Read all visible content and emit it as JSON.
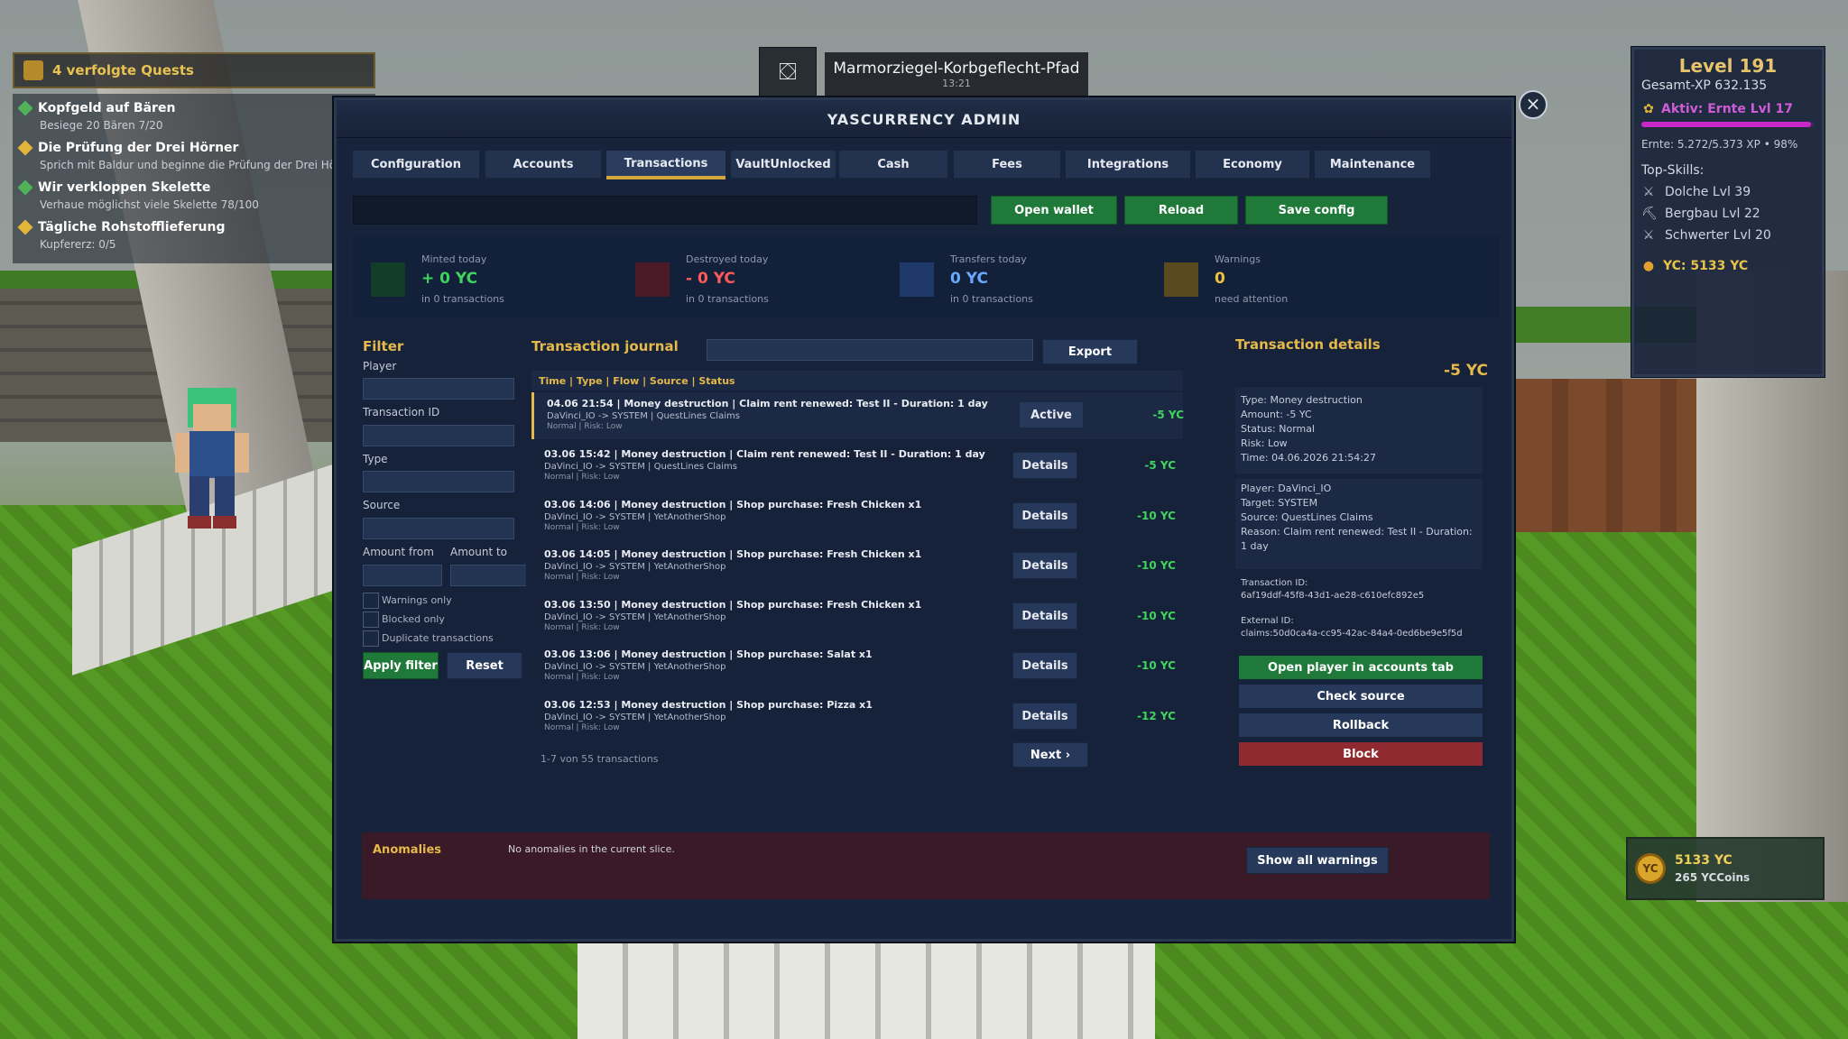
{
  "location": {
    "name": "Marmorziegel-Korbgeflecht-Pfad",
    "time": "13:21"
  },
  "quests": {
    "header": "4 verfolgte Quests",
    "items": [
      {
        "title": "Kopfgeld auf Bären",
        "sub": "Besiege 20 Bären 7/20"
      },
      {
        "title": "Die Prüfung der Drei Hörner",
        "sub": "Sprich mit Baldur und beginne die Prüfung der Drei Hörne"
      },
      {
        "title": "Wir verkloppen Skelette",
        "sub": "Verhaue möglichst viele Skelette 78/100"
      },
      {
        "title": "Tägliche Rohstofflieferung",
        "sub": "Kupfererz: 0/5"
      }
    ]
  },
  "level_panel": {
    "level": "Level 191",
    "xp": "Gesamt-XP 632.135",
    "active": "Aktiv: Ernte Lvl 17",
    "active_progress": 0.98,
    "ernte": "Ernte: 5.272/5.373 XP • 98%",
    "top_skills_label": "Top-Skills:",
    "skills": [
      "Dolche Lvl 39",
      "Bergbau Lvl 22",
      "Schwerter Lvl 20"
    ],
    "yc": "YC: 5133 YC"
  },
  "coin_widget": {
    "badge": "YC",
    "amount": "5133 YC",
    "coins": "265 YCCoins"
  },
  "admin": {
    "title": "YASCURRENCY ADMIN",
    "close": "×",
    "tabs": [
      "Configuration",
      "Accounts",
      "Transactions",
      "VaultUnlocked",
      "Cash",
      "Fees",
      "Integrations",
      "Economy",
      "Maintenance"
    ],
    "active_tab": "Transactions",
    "actions": {
      "open_wallet": "Open wallet",
      "reload": "Reload",
      "save": "Save config"
    },
    "stats": [
      {
        "label": "Minted today",
        "value": "+ 0 YC",
        "sub": "in 0 transactions",
        "color": "#3fd45d",
        "box": "#123e28"
      },
      {
        "label": "Destroyed today",
        "value": "- 0 YC",
        "sub": "in 0 transactions",
        "color": "#ff5a5a",
        "box": "#4a1a26"
      },
      {
        "label": "Transfers today",
        "value": "0 YC",
        "sub": "in 0 transactions",
        "color": "#6aa8ff",
        "box": "#1f3a6a"
      },
      {
        "label": "Warnings",
        "value": "0",
        "sub": "need attention",
        "color": "#f0c040",
        "box": "#5a4a20"
      }
    ],
    "filter": {
      "title": "Filter",
      "player": "Player",
      "txid": "Transaction ID",
      "type": "Type",
      "source": "Source",
      "amount_from": "Amount from",
      "amount_to": "Amount to",
      "warnings_only": "Warnings only",
      "blocked_only": "Blocked only",
      "duplicates": "Duplicate transactions",
      "apply": "Apply filter",
      "reset": "Reset"
    },
    "journal": {
      "title": "Transaction journal",
      "export": "Export",
      "columns": "Time | Type | Flow | Source | Status",
      "rows": [
        {
          "line1": "04.06 21:54 | Money destruction | Claim rent renewed: Test II - Duration: 1 day",
          "line2": "DaVinci_IO -> SYSTEM | QuestLines Claims",
          "line3": "Normal | Risk: Low",
          "button": "Active",
          "amount": "-5 YC"
        },
        {
          "line1": "03.06 15:42 | Money destruction | Claim rent renewed: Test II - Duration: 1 day",
          "line2": "DaVinci_IO -> SYSTEM | QuestLines Claims",
          "line3": "Normal | Risk: Low",
          "button": "Details",
          "amount": "-5 YC"
        },
        {
          "line1": "03.06 14:06 | Money destruction | Shop purchase: Fresh Chicken x1",
          "line2": "DaVinci_IO -> SYSTEM | YetAnotherShop",
          "line3": "Normal | Risk: Low",
          "button": "Details",
          "amount": "-10 YC"
        },
        {
          "line1": "03.06 14:05 | Money destruction | Shop purchase: Fresh Chicken x1",
          "line2": "DaVinci_IO -> SYSTEM | YetAnotherShop",
          "line3": "Normal | Risk: Low",
          "button": "Details",
          "amount": "-10 YC"
        },
        {
          "line1": "03.06 13:50 | Money destruction | Shop purchase: Fresh Chicken x1",
          "line2": "DaVinci_IO -> SYSTEM | YetAnotherShop",
          "line3": "Normal | Risk: Low",
          "button": "Details",
          "amount": "-10 YC"
        },
        {
          "line1": "03.06 13:06 | Money destruction | Shop purchase: Salat x1",
          "line2": "DaVinci_IO -> SYSTEM | YetAnotherShop",
          "line3": "Normal | Risk: Low",
          "button": "Details",
          "amount": "-10 YC"
        },
        {
          "line1": "03.06 12:53 | Money destruction | Shop purchase: Pizza x1",
          "line2": "DaVinci_IO -> SYSTEM | YetAnotherShop",
          "line3": "Normal | Risk: Low",
          "button": "Details",
          "amount": "-12 YC"
        }
      ],
      "pager": "1-7 von 55 transactions",
      "next": "Next ›"
    },
    "details": {
      "title": "Transaction details",
      "amount": "-5 YC",
      "type": "Type: Money destruction",
      "amount_line": "Amount: -5 YC",
      "status": "Status: Normal",
      "risk": "Risk: Low",
      "time": "Time: 04.06.2026 21:54:27",
      "player": "Player: DaVinci_IO",
      "target": "Target: SYSTEM",
      "source": "Source: QuestLines Claims",
      "reason1": "Reason: Claim rent renewed: Test II - Duration:",
      "reason2": "1 day",
      "txid_label": "Transaction ID:",
      "txid": "6af19ddf-45f8-43d1-ae28-c610efc892e5",
      "extid_label": "External ID:",
      "extid": "claims:50d0ca4a-cc95-42ac-84a4-0ed6be9e5f5d",
      "open_player": "Open player in accounts tab",
      "check_source": "Check source",
      "rollback": "Rollback",
      "block": "Block"
    },
    "anomalies": {
      "title": "Anomalies",
      "text": "No anomalies in the current slice.",
      "button": "Show all warnings"
    }
  }
}
